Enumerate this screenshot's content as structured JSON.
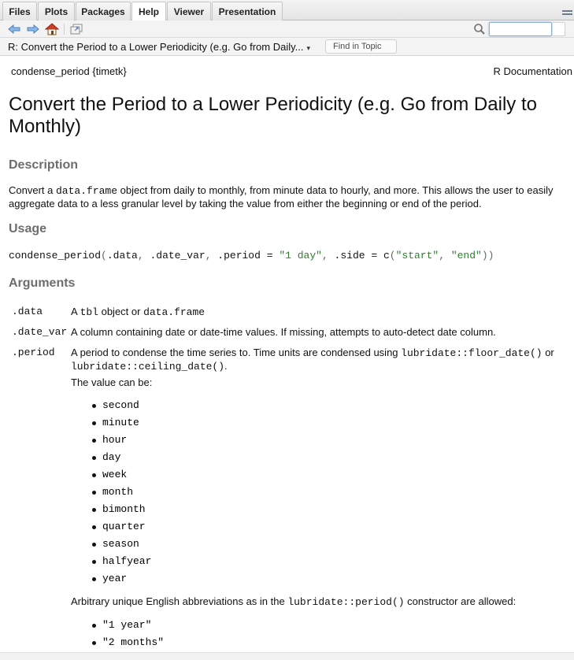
{
  "tabs": [
    {
      "label": "Files"
    },
    {
      "label": "Plots"
    },
    {
      "label": "Packages"
    },
    {
      "label": "Help"
    },
    {
      "label": "Viewer"
    },
    {
      "label": "Presentation"
    }
  ],
  "active_tab": "Help",
  "toolbar": {
    "search_value": "",
    "icons": [
      "back-arrow-icon",
      "forward-arrow-icon",
      "home-icon",
      "popout-window-icon",
      "search-icon"
    ]
  },
  "topic_bar": {
    "title": "R: Convert the Period to a Lower Periodicity (e.g. Go from Daily...",
    "find_placeholder": "Find in Topic"
  },
  "doc": {
    "header_left": "condense_period {timetk}",
    "header_right": "R Documentation",
    "title": "Convert the Period to a Lower Periodicity (e.g. Go from Daily to Monthly)",
    "description_heading": "Description",
    "description": {
      "p1": "Convert a ",
      "code1": "data.frame",
      "p2": " object from daily to monthly, from minute data to hourly, and more. This allows the user to easily aggregate data to a less granular level by taking the value from either the beginning or end of the period."
    },
    "usage_heading": "Usage",
    "usage": {
      "fn": "condense_period",
      "open": "(",
      "a1": ".data",
      "c1": ", ",
      "a2": ".date_var",
      "c2": ", ",
      "a3": ".period ",
      "eq1": "= ",
      "s1": "\"1 day\"",
      "c3": ", ",
      "a4": ".side ",
      "eq2": "= ",
      "fn2": "c",
      "open2": "(",
      "s2": "\"start\"",
      "c4": ", ",
      "s3": "\"end\"",
      "close": "))"
    },
    "arguments_heading": "Arguments",
    "args": {
      "data_name": ".data",
      "data_desc_1": "A ",
      "data_desc_code1": "tbl",
      "data_desc_2": " object or ",
      "data_desc_code2": "data.frame",
      "datevar_name": ".date_var",
      "datevar_desc": "A column containing date or date-time values. If missing, attempts to auto-detect date column.",
      "period_name": ".period",
      "period_desc_1": "A period to condense the time series to. Time units are condensed using ",
      "period_desc_code1": "lubridate::floor_date()",
      "period_desc_2": " or ",
      "period_desc_code2": "lubridate::ceiling_date()",
      "period_desc_3": ".",
      "value_can_be": "The value can be:",
      "values": [
        "second",
        "minute",
        "hour",
        "day",
        "week",
        "month",
        "bimonth",
        "quarter",
        "season",
        "halfyear",
        "year"
      ],
      "abbrev_1": "Arbitrary unique English abbreviations as in the ",
      "abbrev_code": "lubridate::period()",
      "abbrev_2": " constructor are allowed:",
      "examples": [
        "\"1 year\"",
        "\"2 months\""
      ]
    }
  }
}
